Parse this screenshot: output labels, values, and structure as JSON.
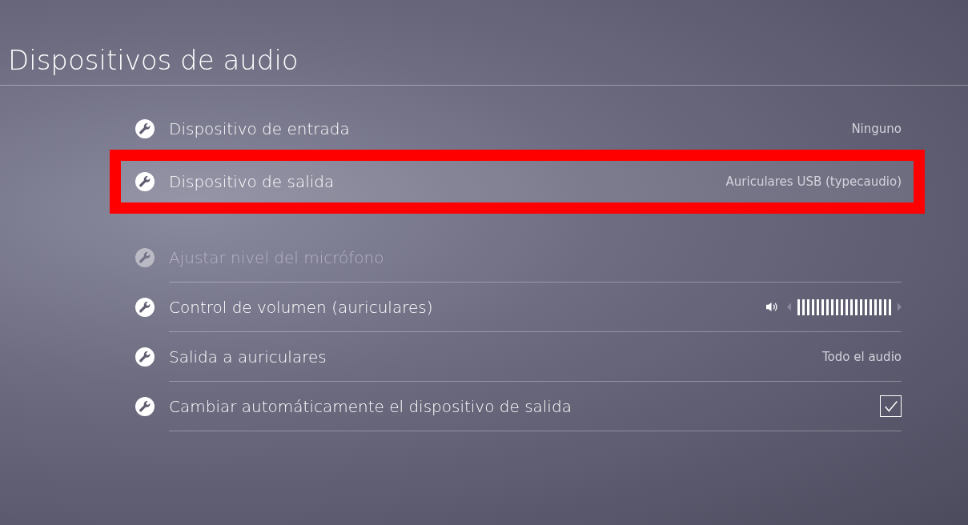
{
  "title": "Dispositivos de audio",
  "groups": [
    {
      "rows": [
        {
          "kind": "value",
          "label": "Dispositivo de entrada",
          "value": "Ninguno",
          "selected": false,
          "highlighted": false,
          "disabled": false,
          "divider": false
        },
        {
          "kind": "value",
          "label": "Dispositivo de salida",
          "value": "Auriculares USB (typecaudio)",
          "selected": true,
          "highlighted": true,
          "disabled": false,
          "divider": false
        }
      ]
    },
    {
      "rows": [
        {
          "kind": "plain",
          "label": "Ajustar nivel del micrófono",
          "selected": false,
          "highlighted": false,
          "disabled": true,
          "divider": true
        },
        {
          "kind": "slider",
          "label": "Control de volumen (auriculares)",
          "level": 1,
          "selected": false,
          "highlighted": false,
          "disabled": false,
          "divider": true
        },
        {
          "kind": "value",
          "label": "Salida a auriculares",
          "value": "Todo el audio",
          "selected": false,
          "highlighted": false,
          "disabled": false,
          "divider": true
        },
        {
          "kind": "checkbox",
          "label": "Cambiar automáticamente el dispositivo de salida",
          "checked": true,
          "selected": false,
          "highlighted": false,
          "disabled": false,
          "divider": true
        }
      ]
    }
  ]
}
